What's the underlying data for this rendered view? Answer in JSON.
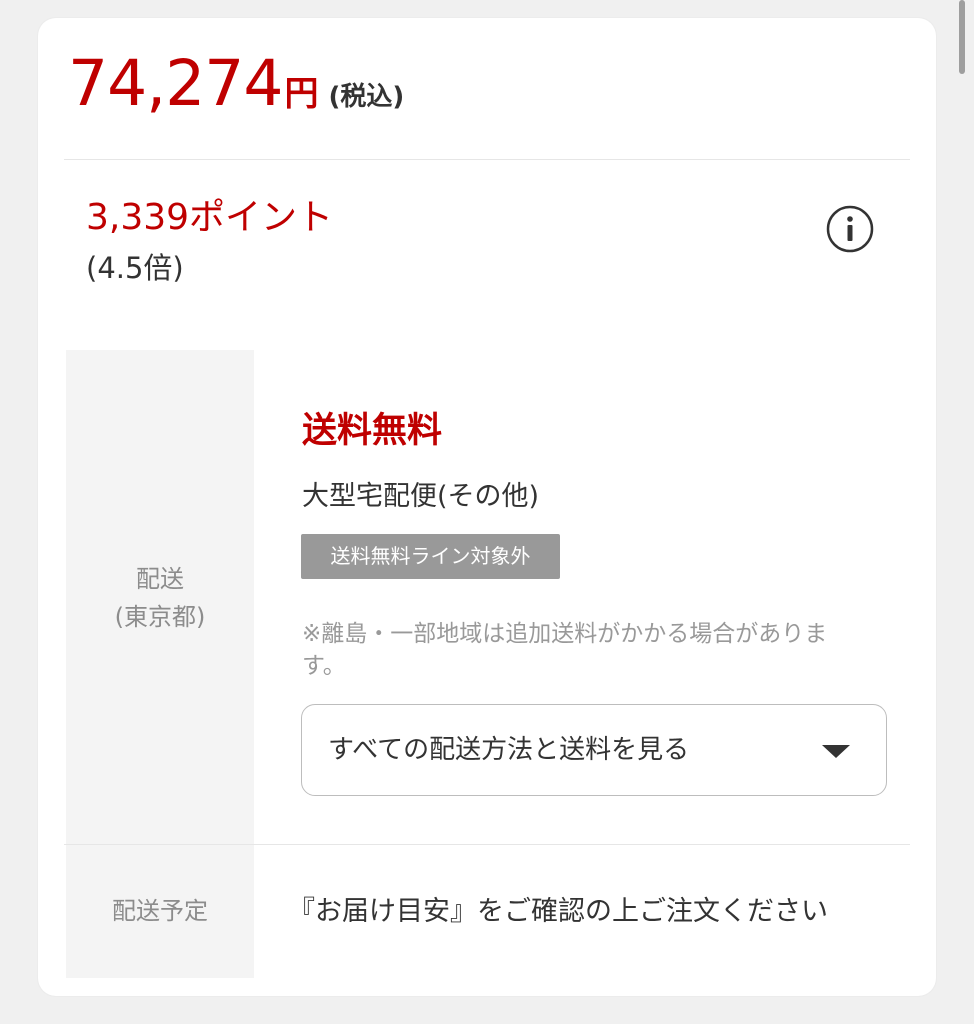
{
  "price": {
    "amount": "74,274",
    "unit": "円",
    "tax_note": "(税込)"
  },
  "points": {
    "amount": "3,339ポイント",
    "rate": "(4.5倍)",
    "info_icon": "info-circle-icon"
  },
  "shipping": {
    "label_line1": "配送",
    "label_line2": "(東京都)",
    "free_shipping": "送料無料",
    "delivery_type": "大型宅配便(その他)",
    "badge": "送料無料ライン対象外",
    "note": "※離島・一部地域は追加送料がかかる場合があります。",
    "dropdown_label": "すべての配送方法と送料を見る",
    "dropdown_icon": "caret-down-icon"
  },
  "schedule": {
    "label": "配送予定",
    "text": "『お届け目安』をご確認の上ご注文ください"
  },
  "colors": {
    "accent_red": "#bf0000",
    "badge_gray": "#999999",
    "label_bg": "#f4f4f4"
  }
}
